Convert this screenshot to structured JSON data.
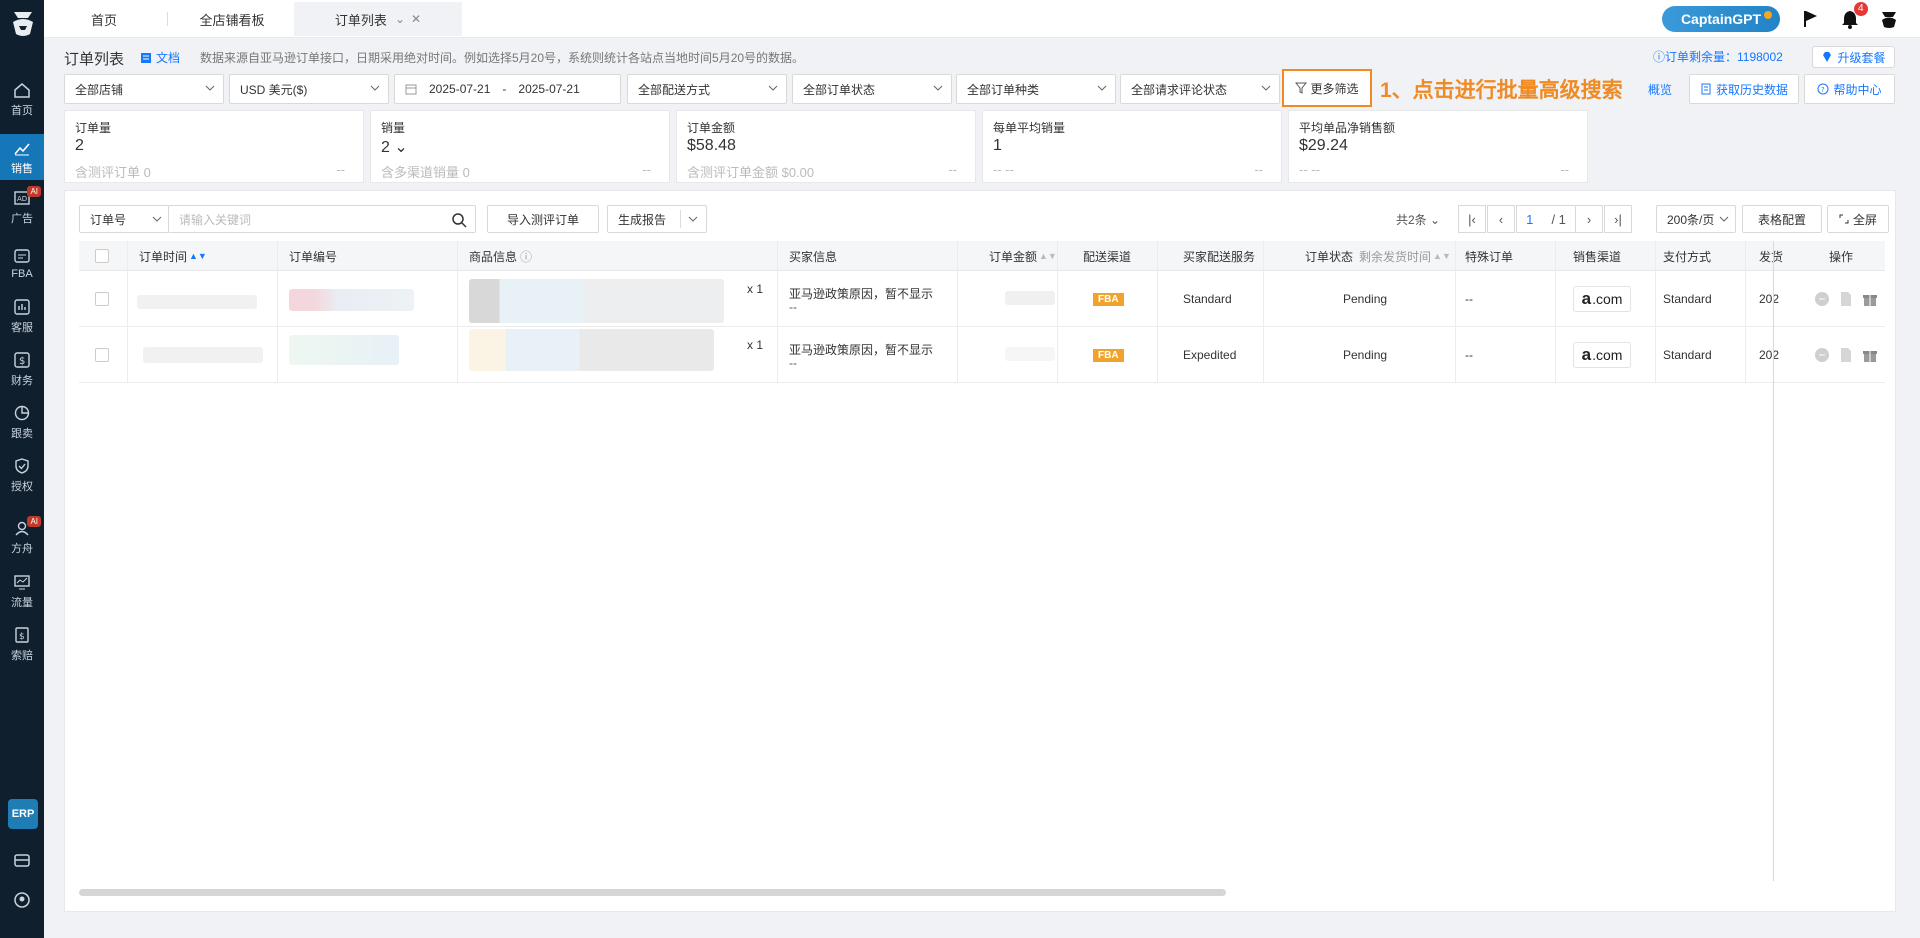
{
  "sidebar": {
    "items": [
      {
        "label": "首页",
        "icon": "home-icon"
      },
      {
        "label": "销售",
        "icon": "chart-line-icon",
        "active": true
      },
      {
        "label": "广告",
        "icon": "ad-icon",
        "badge": "AI"
      },
      {
        "label": "FBA",
        "icon": "fba-icon"
      },
      {
        "label": "客服",
        "icon": "service-icon"
      },
      {
        "label": "财务",
        "icon": "finance-icon"
      },
      {
        "label": "跟卖",
        "icon": "pie-icon"
      },
      {
        "label": "授权",
        "icon": "shield-icon"
      },
      {
        "label": "方舟",
        "icon": "ark-icon",
        "badge": "AI"
      },
      {
        "label": "流量",
        "icon": "traffic-icon"
      },
      {
        "label": "索赔",
        "icon": "claim-icon"
      }
    ],
    "erp": "ERP"
  },
  "tabs": [
    {
      "label": "首页"
    },
    {
      "label": "全店铺看板"
    },
    {
      "label": "订单列表",
      "active": true
    }
  ],
  "top": {
    "captain": "CaptainGPT",
    "bell_count": "4"
  },
  "header": {
    "title": "订单列表",
    "doc": "文档",
    "notice": "数据来源自亚马逊订单接口，日期采用绝对时间。例如选择5月20号，系统则统计各站点当地时间5月20号的数据。",
    "remaining": "ⓘ订单剩余量：1198002",
    "upgrade": "升级套餐"
  },
  "filters": {
    "store": "全部店铺",
    "currency": "USD  美元($)",
    "date_start": "2025-07-21",
    "date_sep": "-",
    "date_end": "2025-07-21",
    "delivery": "全部配送方式",
    "order_status": "全部订单状态",
    "order_type": "全部订单种类",
    "review_status": "全部请求评论状态",
    "more": "更多筛选",
    "annotation": "1、点击进行批量高级搜索",
    "overview": "概览",
    "history": "获取历史数据",
    "help": "帮助中心"
  },
  "stats": [
    {
      "label": "订单量",
      "value": "2",
      "sub": "含测评订单 0",
      "dash": "--"
    },
    {
      "label": "销量",
      "value": "2 ⌄",
      "sub": "含多渠道销量 0",
      "dash": "--"
    },
    {
      "label": "订单金额",
      "value": "$58.48",
      "sub": "含测评订单金额 $0.00",
      "dash": "--"
    },
    {
      "label": "每单平均销量",
      "value": "1",
      "sub": "-- --",
      "dash": "--"
    },
    {
      "label": "平均单品净销售额",
      "value": "$29.24",
      "sub": "-- --",
      "dash": "--"
    }
  ],
  "toolbar": {
    "search_field": "订单号",
    "search_placeholder": "请输入关键词",
    "import": "导入测评订单",
    "report": "生成报告",
    "total": "共2条",
    "page": "1",
    "page_total": "/ 1",
    "page_size": "200条/页",
    "table_config": "表格配置",
    "fullscreen": "全屏"
  },
  "table": {
    "headers": {
      "order_time": "订单时间",
      "order_no": "订单编号",
      "product": "商品信息",
      "buyer": "买家信息",
      "amount": "订单金额",
      "channel": "配送渠道",
      "service": "买家配送服务",
      "status": "订单状态",
      "remain_time": "剩余发货时间",
      "special": "特殊订单",
      "sales_channel": "销售渠道",
      "payment": "支付方式",
      "ship": "发货",
      "ops": "操作"
    },
    "rows": [
      {
        "qty": "x 1",
        "buyer": "亚马逊政策原因，暂不显示",
        "buyer2": "--",
        "channel": "FBA",
        "service": "Standard",
        "status": "Pending",
        "special": "--",
        "sales_channel": ".com",
        "payment": "Standard",
        "ship": "202"
      },
      {
        "qty": "x 1",
        "buyer": "亚马逊政策原因，暂不显示",
        "buyer2": "--",
        "channel": "FBA",
        "service": "Expedited",
        "status": "Pending",
        "special": "--",
        "sales_channel": ".com",
        "payment": "Standard",
        "ship": "202"
      }
    ]
  },
  "colors": {
    "accent": "#1677b8",
    "annotation": "#f08a24",
    "fba": "#f0a32a"
  }
}
